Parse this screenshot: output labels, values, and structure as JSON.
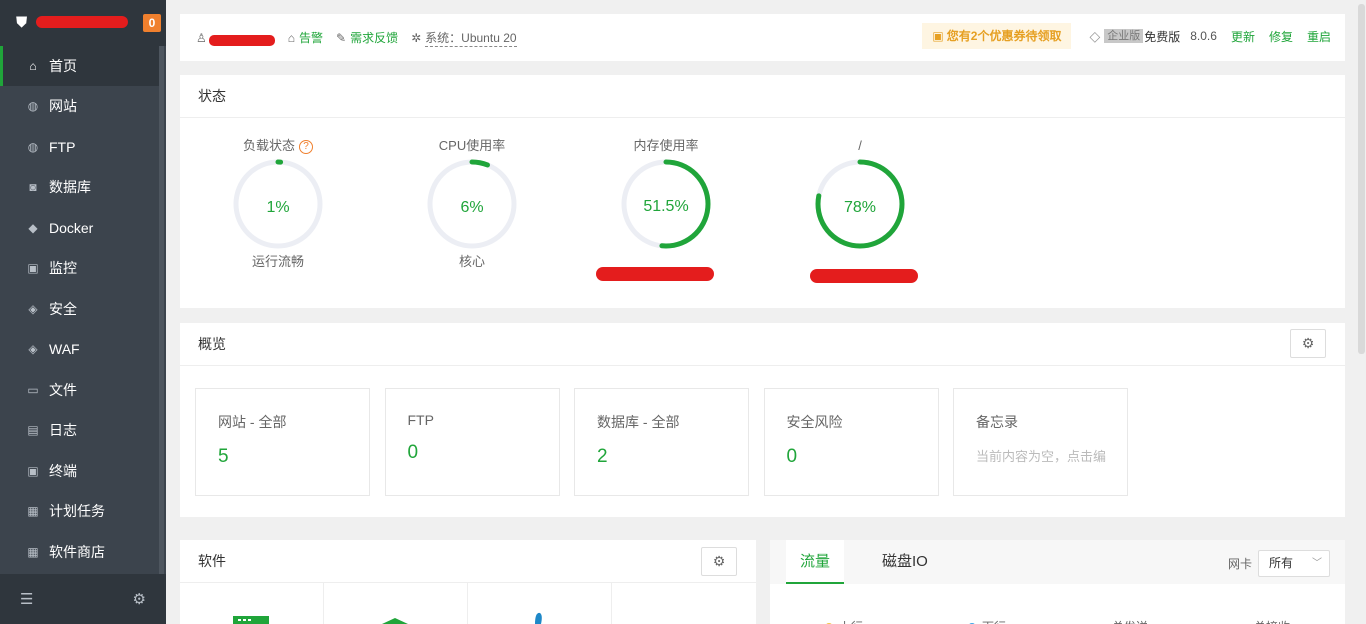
{
  "sidebar": {
    "badge": "0",
    "items": [
      {
        "label": "首页",
        "icon": "home-icon",
        "glyph": "⌂"
      },
      {
        "label": "网站",
        "icon": "globe-icon",
        "glyph": "◍"
      },
      {
        "label": "FTP",
        "icon": "ftp-globe-icon",
        "glyph": "◍"
      },
      {
        "label": "数据库",
        "icon": "database-icon",
        "glyph": "◙"
      },
      {
        "label": "Docker",
        "icon": "docker-icon",
        "glyph": "◆"
      },
      {
        "label": "监控",
        "icon": "monitor-icon",
        "glyph": "▣"
      },
      {
        "label": "安全",
        "icon": "shield-icon",
        "glyph": "◈"
      },
      {
        "label": "WAF",
        "icon": "waf-shield-icon",
        "glyph": "◈"
      },
      {
        "label": "文件",
        "icon": "folder-icon",
        "glyph": "▭"
      },
      {
        "label": "日志",
        "icon": "log-icon",
        "glyph": "▤"
      },
      {
        "label": "终端",
        "icon": "terminal-icon",
        "glyph": "▣"
      },
      {
        "label": "计划任务",
        "icon": "calendar-icon",
        "glyph": "▦"
      },
      {
        "label": "软件商店",
        "icon": "apps-icon",
        "glyph": "▦"
      }
    ]
  },
  "topbar": {
    "alert": "告警",
    "feedback": "需求反馈",
    "system": "系统：Ubuntu 20",
    "coupon": "您有2个优惠券待领取",
    "edition_tag": "企业版",
    "free": "免费版",
    "version": "8.0.6",
    "update": "更新",
    "repair": "修复",
    "restart": "重启"
  },
  "status": {
    "title": "状态",
    "gauges": [
      {
        "title": "负载状态",
        "value": "1%",
        "fraction": 0.01,
        "foot": "运行流畅"
      },
      {
        "title": "CPU使用率",
        "value": "6%",
        "fraction": 0.06,
        "foot": "核心"
      },
      {
        "title": "内存使用率",
        "value": "51.5%",
        "fraction": 0.515,
        "foot": ""
      },
      {
        "title": "/",
        "value": "78%",
        "fraction": 0.78,
        "foot": ""
      }
    ]
  },
  "overview": {
    "title": "概览",
    "cards": [
      {
        "label": "网站 - 全部",
        "value": "5"
      },
      {
        "label": "FTP",
        "value": "0"
      },
      {
        "label": "数据库 - 全部",
        "value": "2"
      },
      {
        "label": "安全风险",
        "value": "0"
      },
      {
        "label": "备忘录",
        "placeholder": "当前内容为空，点击编辑"
      }
    ]
  },
  "software": {
    "title": "软件"
  },
  "traffic": {
    "tab_traffic": "流量",
    "tab_disk": "磁盘IO",
    "nic_label": "网卡",
    "nic_value": "所有",
    "legend": [
      "上行",
      "下行",
      "总发送",
      "总接收"
    ]
  },
  "colors": {
    "accent": "#20a53a",
    "warning": "#f0802e",
    "track": "#eceef4",
    "sidebar": "#3c444d"
  }
}
